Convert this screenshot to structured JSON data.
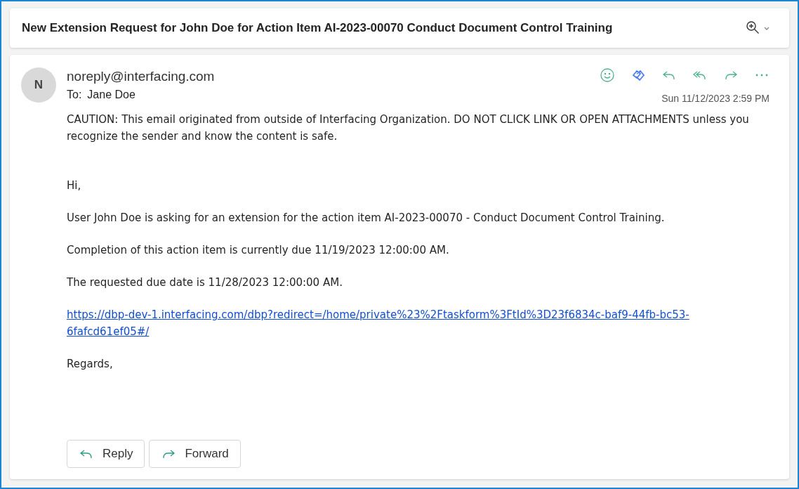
{
  "subject": "New Extension Request for John Doe for Action Item AI-2023-00070 Conduct Document Control Training",
  "message": {
    "avatar": "N",
    "from": "noreply@interfacing.com",
    "to_label": "To:",
    "to": "Jane Doe",
    "date": "Sun 11/12/2023 2:59 PM",
    "caution": "CAUTION: This email originated from outside of Interfacing Organization. DO NOT CLICK LINK OR OPEN ATTACHMENTS unless you recognize the sender and know the content is safe.",
    "body": [
      {
        "kind": "text",
        "text": "Hi,"
      },
      {
        "kind": "text",
        "text": "User John Doe is asking for an extension for the action item AI-2023-00070 - Conduct Document Control Training."
      },
      {
        "kind": "text",
        "text": "Completion of this action item is currently due 11/19/2023 12:00:00 AM."
      },
      {
        "kind": "text",
        "text": "The requested due date is 11/28/2023 12:00:00 AM."
      },
      {
        "kind": "link",
        "text": "https://dbp-dev-1.interfacing.com/dbp?redirect=/home/private%23%2Ftaskform%3FtId%3D23f6834c-baf9-44fb-bc53-6fafcd61ef05#/"
      },
      {
        "kind": "text",
        "text": "Regards,"
      }
    ]
  },
  "buttons": [
    {
      "kind": "reply",
      "label": "Reply"
    },
    {
      "kind": "forward",
      "label": "Forward"
    }
  ]
}
